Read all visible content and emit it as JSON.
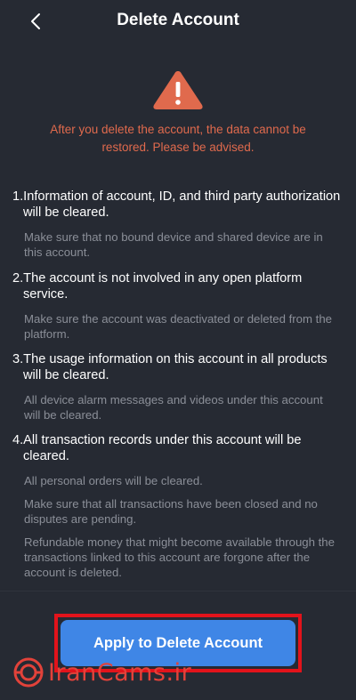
{
  "header": {
    "title": "Delete Account",
    "back_icon": "chevron-left-icon"
  },
  "warning": {
    "icon": "warning-triangle-icon",
    "color": "#e06a4d",
    "text": "After you delete the account, the data cannot be restored. Please be advised."
  },
  "sections": [
    {
      "title": "1.Information of account, ID, and third party authorization will be cleared.",
      "notes": [
        "Make sure that no bound device and shared device are in this account."
      ]
    },
    {
      "title": "2.The account is not involved in any open platform service.",
      "notes": [
        "Make sure the account was deactivated or deleted from the platform."
      ]
    },
    {
      "title": "3.The usage information on this account in all products will be cleared.",
      "notes": [
        "All device alarm messages and videos under this account will be cleared."
      ]
    },
    {
      "title": "4.All transaction records under this account will be cleared.",
      "notes": [
        "All personal orders will be cleared.",
        "Make sure that all transactions have been closed and no disputes are pending.",
        "Refundable money that might become available through the transactions linked to this account are forgone after the account is deleted."
      ]
    }
  ],
  "footer": {
    "apply_label": "Apply to Delete Account",
    "button_color": "#3f86e6",
    "highlight_color": "#e2131b"
  },
  "watermark": {
    "logo_text": "IranCams.ir"
  }
}
